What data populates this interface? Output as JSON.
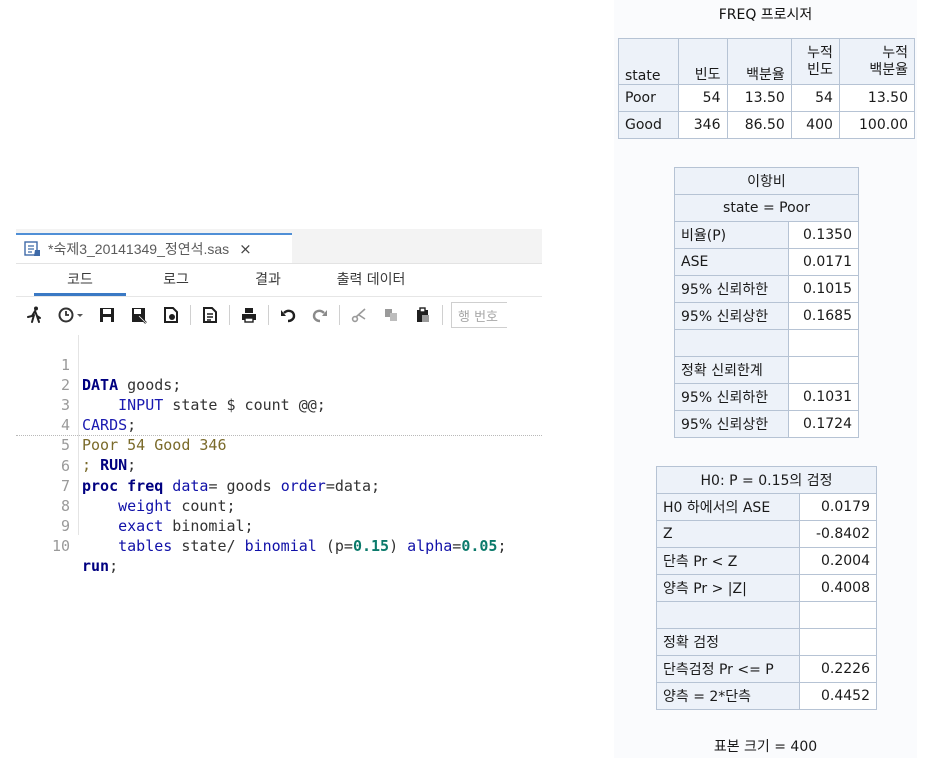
{
  "editor": {
    "file_tab": {
      "name": "*숙제3_20141349_정연석.sas",
      "close": "×"
    },
    "subtabs": [
      "코드",
      "로그",
      "결과",
      "출력 데이터"
    ],
    "active_subtab": "코드",
    "toolbar": {
      "icons": [
        "run-icon",
        "history-icon",
        "save-icon",
        "save-as-icon",
        "export-icon",
        "format-icon",
        "print-icon",
        "undo-icon",
        "redo-icon",
        "cut-icon",
        "copy-icon",
        "paste-icon"
      ],
      "line_number_placeholder": "행 번호"
    },
    "line_numbers": [
      "1",
      "2",
      "3",
      "4",
      "5",
      "6",
      "7",
      "8",
      "9",
      "10"
    ],
    "code": {
      "l1": {
        "kw": "DATA",
        "rest": " goods;"
      },
      "l2": {
        "kw": "    INPUT",
        "rest": " state $ count @@;"
      },
      "l3": {
        "kw": "CARDS",
        "rest": ";"
      },
      "l4": {
        "text": "Poor 54 Good 346"
      },
      "l5": {
        "pre": "; ",
        "kw": "RUN",
        "rest": ";"
      },
      "l6": {
        "kw": "proc freq",
        "opt1": " data",
        "mid": "= goods ",
        "opt2": "order",
        "rest": "=data;"
      },
      "l7": {
        "kw": "    weight",
        "rest": " count;"
      },
      "l8": {
        "kw": "    exact",
        "rest": " binomial;"
      },
      "l9": {
        "kw": "    tables",
        "mid": " state/ ",
        "opt1": "binomial",
        "mid2": " (p=",
        "n1": "0.15",
        "mid3": ") ",
        "opt2": "alpha",
        "mid4": "=",
        "n2": "0.05",
        "rest": ";"
      },
      "l10": {
        "kw": "run",
        "rest": ";"
      }
    }
  },
  "results": {
    "proc_title": "FREQ 프로시저",
    "freq_table": {
      "headers": [
        "state",
        "빈도",
        "백분율",
        "누적 빈도",
        "누적 백분율"
      ],
      "header_lines": [
        [
          "state"
        ],
        [
          "빈도"
        ],
        [
          "백분율"
        ],
        [
          "누적",
          "빈도"
        ],
        [
          "누적",
          "백분율"
        ]
      ],
      "rows": [
        [
          "Poor",
          "54",
          "13.50",
          "54",
          "13.50"
        ],
        [
          "Good",
          "346",
          "86.50",
          "400",
          "100.00"
        ]
      ]
    },
    "binomial_table": {
      "title": "이항비",
      "subtitle": "state = Poor",
      "rows": [
        [
          "비율(P)",
          "0.1350"
        ],
        [
          "ASE",
          "0.0171"
        ],
        [
          "95% 신뢰하한",
          "0.1015"
        ],
        [
          "95% 신뢰상한",
          "0.1685"
        ],
        [
          "",
          ""
        ],
        [
          "정확 신뢰한계",
          ""
        ],
        [
          "95% 신뢰하한",
          "0.1031"
        ],
        [
          "95% 신뢰상한",
          "0.1724"
        ]
      ]
    },
    "test_table": {
      "title": "H0: P = 0.15의 검정",
      "rows": [
        [
          "H0 하에서의 ASE",
          "0.0179"
        ],
        [
          "Z",
          "-0.8402"
        ],
        [
          "단측 Pr < Z",
          "0.2004"
        ],
        [
          "양측 Pr > |Z|",
          "0.4008"
        ],
        [
          "",
          ""
        ],
        [
          "정확 검정",
          ""
        ],
        [
          "단측검정 Pr <= P",
          "0.2226"
        ],
        [
          "양측 = 2*단측",
          "0.4452"
        ]
      ]
    },
    "sample_size": "표본 크기 = 400"
  }
}
